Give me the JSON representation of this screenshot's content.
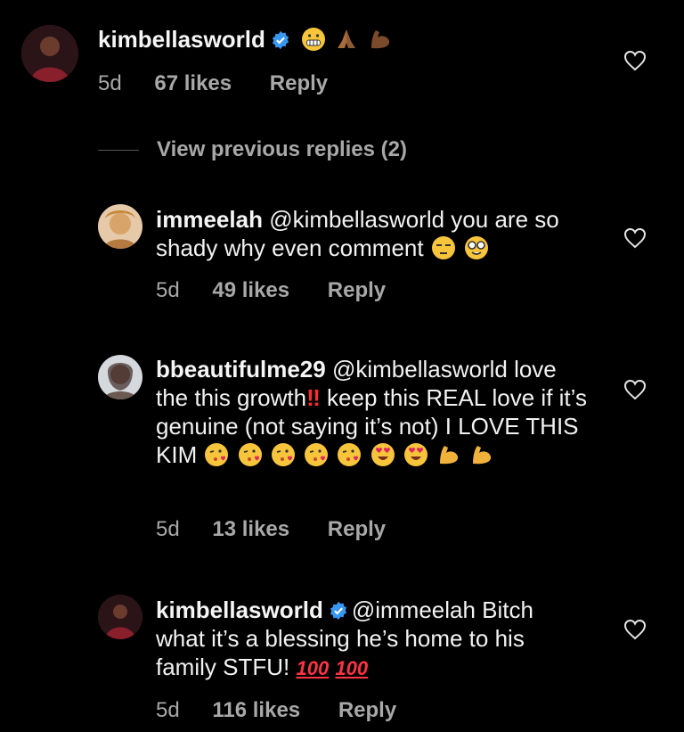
{
  "comments": [
    {
      "username": "kimbellasworld",
      "verified": true,
      "text": "",
      "time": "5d",
      "likes": "67 likes",
      "reply": "Reply"
    },
    {
      "username": "immeelah",
      "text": "@kimbellasworld you are so shady why even comment",
      "time": "5d",
      "likes": "49 likes",
      "reply": "Reply"
    },
    {
      "username": "bbeautifulme29",
      "text_part1": "@kimbellasworld love the this growth",
      "text_part2": "keep this REAL love if it’s genuine (not saying it’s not) I LOVE THIS KIM",
      "time": "5d",
      "likes": "13 likes",
      "reply": "Reply"
    },
    {
      "username": "kimbellasworld",
      "verified": true,
      "text": "@immeelah Bitch what it’s a blessing he’s home to his family STFU!",
      "time": "5d",
      "likes": "116 likes",
      "reply": "Reply"
    }
  ],
  "view_previous": "View previous replies (2)",
  "icons": {
    "like": "heart-outline-icon",
    "verified": "verified-badge-icon"
  },
  "colors": {
    "background": "#000000",
    "text": "#f5f5f5",
    "meta": "#a8a8a8",
    "verified": "#3897f0"
  }
}
